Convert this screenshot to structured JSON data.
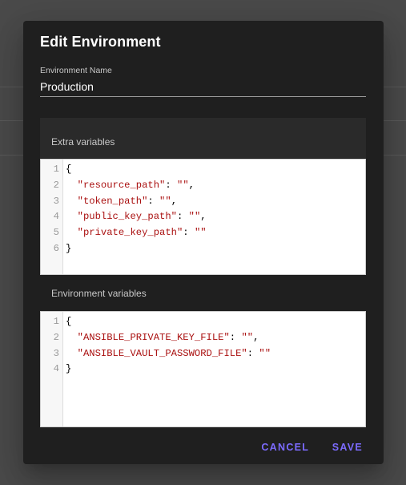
{
  "dialog": {
    "title": "Edit Environment",
    "name_label": "Environment Name",
    "name_value": "Production",
    "extra_label": "Extra variables",
    "env_label": "Environment variables",
    "cancel_label": "CANCEL",
    "save_label": "SAVE"
  },
  "extra_editor": {
    "line_numbers": [
      "1",
      "2",
      "3",
      "4",
      "5",
      "6"
    ],
    "lines": [
      {
        "pre": "{",
        "key": "",
        "mid": "",
        "val": "",
        "post": ""
      },
      {
        "pre": "  ",
        "key": "\"resource_path\"",
        "mid": ": ",
        "val": "\"\"",
        "post": ","
      },
      {
        "pre": "  ",
        "key": "\"token_path\"",
        "mid": ": ",
        "val": "\"\"",
        "post": ","
      },
      {
        "pre": "  ",
        "key": "\"public_key_path\"",
        "mid": ": ",
        "val": "\"\"",
        "post": ","
      },
      {
        "pre": "  ",
        "key": "\"private_key_path\"",
        "mid": ": ",
        "val": "\"\"",
        "post": ""
      },
      {
        "pre": "}",
        "key": "",
        "mid": "",
        "val": "",
        "post": ""
      }
    ]
  },
  "env_editor": {
    "line_numbers": [
      "1",
      "2",
      "3",
      "4"
    ],
    "lines": [
      {
        "pre": "{",
        "key": "",
        "mid": "",
        "val": "",
        "post": ""
      },
      {
        "pre": "  ",
        "key": "\"ANSIBLE_PRIVATE_KEY_FILE\"",
        "mid": ": ",
        "val": "\"\"",
        "post": ","
      },
      {
        "pre": "  ",
        "key": "\"ANSIBLE_VAULT_PASSWORD_FILE\"",
        "mid": ": ",
        "val": "\"\"",
        "post": ""
      },
      {
        "pre": "}",
        "key": "",
        "mid": "",
        "val": "",
        "post": ""
      }
    ]
  },
  "colors": {
    "accent": "#7c6bff",
    "string": "#a11111",
    "dialog_bg": "#1f1f1f"
  }
}
